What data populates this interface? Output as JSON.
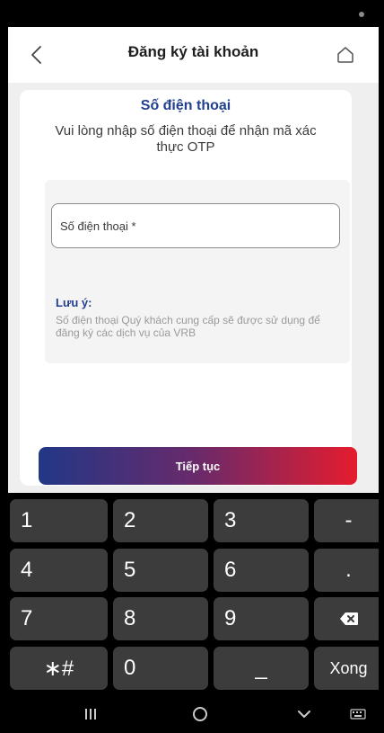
{
  "app": {
    "title": "Đăng ký tài khoản",
    "heading": "Số điện thoại",
    "description": "Vui lòng nhập số điện thoại để nhận mã xác thực OTP"
  },
  "form": {
    "phone_value": "",
    "phone_placeholder": "Số điện thoại *",
    "note_title": "Lưu ý:",
    "note_text": "Số điện thoại Quý khách cung cấp sẽ được sử dụng để đăng ký các dịch vụ của VRB",
    "continue_label": "Tiếp tục"
  },
  "keyboard": {
    "k1": "1",
    "k2": "2",
    "k3": "3",
    "minus": "-",
    "k4": "4",
    "k5": "5",
    "k6": "6",
    "dot": ".",
    "k7": "7",
    "k8": "8",
    "k9": "9",
    "symbols": "∗#",
    "k0": "0",
    "space": "_",
    "done": "Xong"
  },
  "icons": {
    "back": "chevron-left-icon",
    "home": "home-icon",
    "backspace": "backspace-icon",
    "recent_apps": "recent-apps-icon",
    "home_nav": "circle-home-icon",
    "hide_keyboard": "chevron-down-icon",
    "keyboard_switch": "keyboard-icon"
  },
  "colors": {
    "brand_blue": "#223e8f",
    "gradient_start": "#223786",
    "gradient_end": "#e61c2e"
  }
}
